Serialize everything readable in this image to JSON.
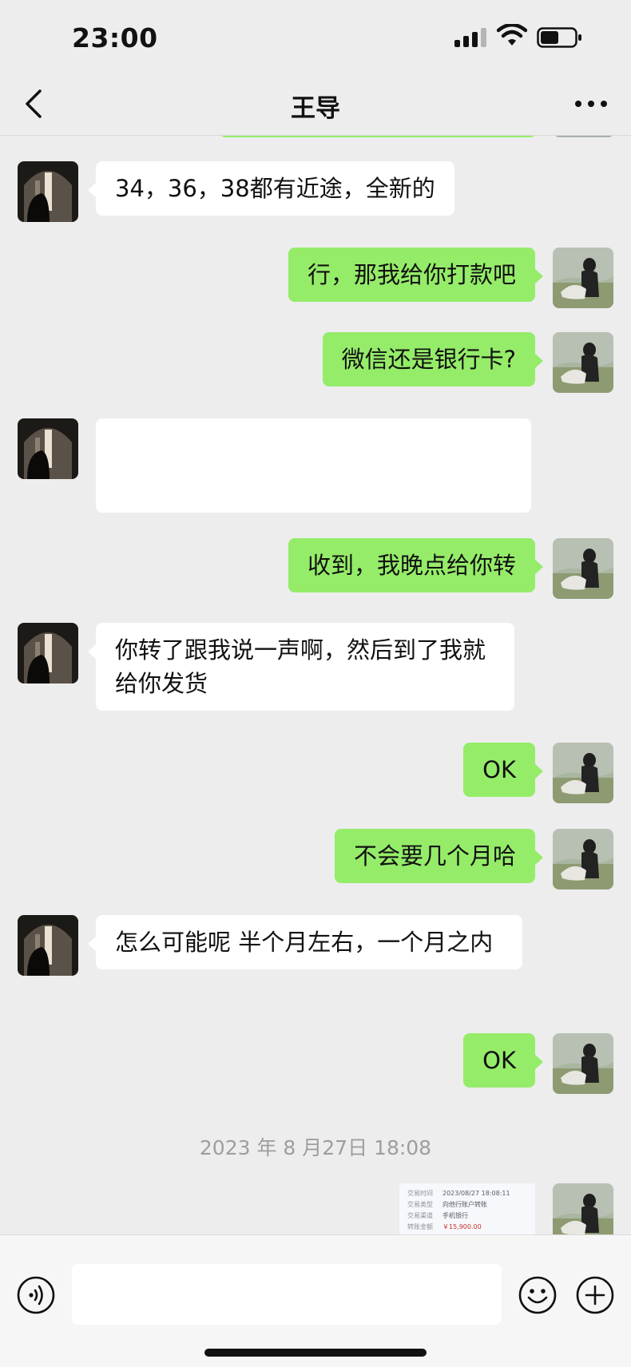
{
  "status_bar": {
    "time": "23:00",
    "icons": [
      "signal-icon",
      "wifi-icon",
      "battery-icon"
    ]
  },
  "header": {
    "title": "王导",
    "back_icon": "chevron-left-icon",
    "more_icon": "more-dots-icon"
  },
  "messages": [
    {
      "side": "in",
      "text": "34，36，38都有近途，全新的"
    },
    {
      "side": "out",
      "text": "行，那我给你打款吧"
    },
    {
      "side": "out",
      "text": "微信还是银行卡?"
    },
    {
      "side": "in",
      "text": ""
    },
    {
      "side": "out",
      "text": "收到，我晚点给你转"
    },
    {
      "side": "in",
      "text": "你转了跟我说一声啊，然后到了我就给你发货"
    },
    {
      "side": "out",
      "text": "OK"
    },
    {
      "side": "out",
      "text": "不会要几个月哈"
    },
    {
      "side": "in",
      "text": "怎么可能呢 半个月左右，一个月之内"
    },
    {
      "side": "out",
      "text": "OK"
    }
  ],
  "timestamp": "2023 年 8 月27日 18:08",
  "receipt": {
    "rows": [
      {
        "label": "交易时间",
        "value": "2023/08/27 18:08:11"
      },
      {
        "label": "交易类型",
        "value": "向他行账户转账"
      },
      {
        "label": "交易渠道",
        "value": "手机银行"
      },
      {
        "label": "转账金额",
        "value": "￥15,900.00"
      }
    ]
  },
  "input_bar": {
    "voice_icon": "voice-icon",
    "emoji_icon": "emoji-icon",
    "plus_icon": "plus-icon"
  },
  "colors": {
    "background": "#ededed",
    "outgoing_bubble": "#95ec69",
    "incoming_bubble": "#ffffff",
    "timestamp_text": "#9e9e9e"
  }
}
